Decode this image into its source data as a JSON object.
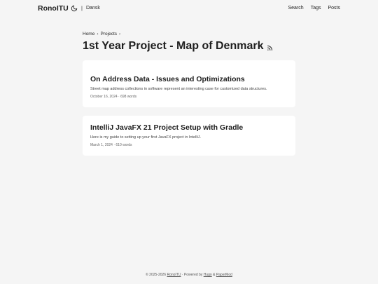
{
  "header": {
    "logo": "RonoITU",
    "separator": "|",
    "language": "Dansk",
    "nav": {
      "search": "Search",
      "tags": "Tags",
      "posts": "Posts"
    }
  },
  "breadcrumbs": {
    "home": "Home",
    "projects": "Projects",
    "separator": "›"
  },
  "page_title": "1st Year Project - Map of Denmark",
  "posts": [
    {
      "title": "On Address Data - Issues and Optimizations",
      "summary": "Street map address collections in software represent an interesting case for customized data structures.",
      "meta": "October 16, 2024 · 698 words"
    },
    {
      "title": "IntelliJ JavaFX 21 Project Setup with Gradle",
      "summary": "Here is my guide to setting up your first JavaFX project in IntelliJ.",
      "meta": "March 1, 2024 · 610 words"
    }
  ],
  "footer": {
    "copyright": "© 2025-2026",
    "owner_link": "RonoITU",
    "powered_by": " · Powered by ",
    "hugo_link": "Hugo",
    "amp": " & ",
    "papermod_link": "PaperMod"
  },
  "colors": {
    "background": "#f5f5f5",
    "card": "#ffffff",
    "text": "#1f1f1f"
  }
}
